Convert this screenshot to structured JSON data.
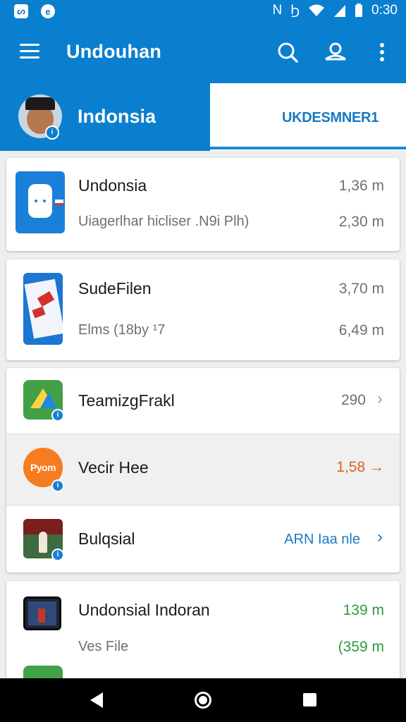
{
  "status_bar": {
    "left_icons": [
      "notification-app-icon",
      "notification-circle-icon"
    ],
    "right_icons": [
      "nfc-icon",
      "data-icon",
      "wifi-icon",
      "signal-icon",
      "battery-icon"
    ],
    "time": "0:30"
  },
  "app_bar": {
    "title": "Undouhan",
    "icons": [
      "menu-icon",
      "search-icon",
      "account-icon",
      "more-vert-icon"
    ]
  },
  "tabs": {
    "active_label": "Indonsia",
    "other_label": "UKDESMNER1"
  },
  "cards": {
    "item1": {
      "title": "Undonsia",
      "subtitle": "Uiagerlhar hicliser .N9i Plh)",
      "value1": "1,36 m",
      "value2": "2,30 m"
    },
    "item2": {
      "title": "SudeFilen",
      "subtitle": "Elms (18by ¹7",
      "value1": "3,70 m",
      "value2": "6,49 m"
    },
    "item3": {
      "title": "TeamizgFrakl",
      "value": "290",
      "chevron": "›"
    },
    "item4": {
      "title": "Vecir Hee",
      "icon_text": "Pyom",
      "value": "1,58 →"
    },
    "item5": {
      "title": "Bulqsial",
      "value": "ARN Iaa nle",
      "chevron": "›"
    },
    "item6": {
      "title": "Undonsial Indoran",
      "subtitle": "Ves File",
      "value1": "139 m",
      "value2": "(359 m"
    }
  },
  "colors": {
    "primary": "#0a7fd0",
    "accent_orange": "#e0601c",
    "accent_green": "#2e9b3a",
    "link_blue": "#1a7bc4"
  },
  "nav_bar": {
    "icons": [
      "back-icon",
      "home-icon",
      "recents-icon"
    ]
  }
}
